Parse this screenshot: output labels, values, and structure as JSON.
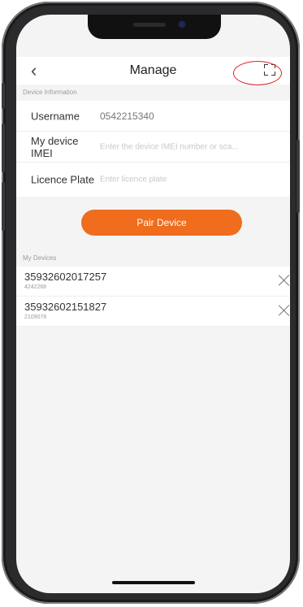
{
  "nav": {
    "title": "Manage",
    "back_icon": "chevron-left-icon",
    "scan_icon": "scan-icon"
  },
  "device_info": {
    "section_label": "Device Information",
    "username_label": "Username",
    "username_value": "0542215340",
    "imei_label": "My device IMEI",
    "imei_placeholder": "Enter the device IMEI number or sca...",
    "plate_label": "Licence Plate",
    "plate_placeholder": "Enter licence plate"
  },
  "pair_button": "Pair Device",
  "my_devices": {
    "section_label": "My Devices",
    "items": [
      {
        "imei": "35932602017257",
        "code": "4242266"
      },
      {
        "imei": "35932602151827",
        "code": "2109076"
      }
    ]
  },
  "colors": {
    "accent": "#ef6d1c",
    "annotation": "#d9262b"
  }
}
